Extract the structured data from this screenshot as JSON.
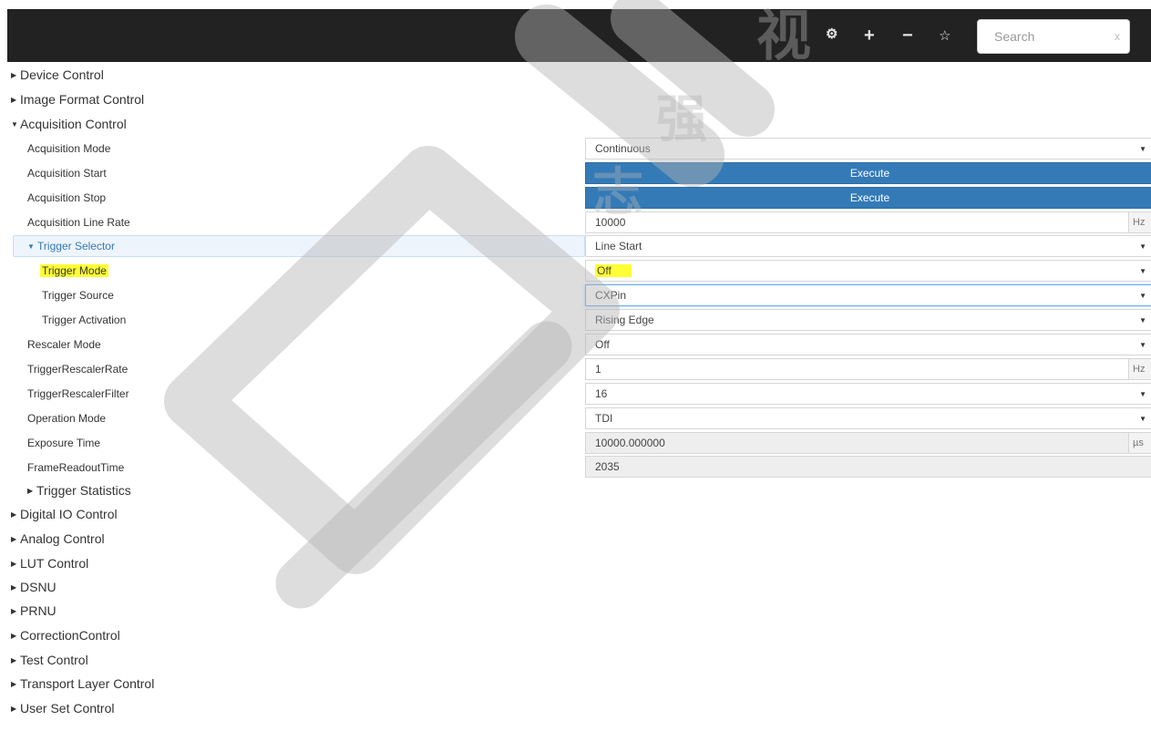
{
  "toolbar": {
    "icons": [
      "gear-icon",
      "plus-icon",
      "minus-icon",
      "star-icon"
    ],
    "search": {
      "placeholder": "Search",
      "clear": "x"
    }
  },
  "tree": {
    "device_control": "Device Control",
    "image_format_control": "Image Format Control",
    "acquisition_control": "Acquisition Control",
    "digital_io_control": "Digital IO Control",
    "analog_control": "Analog Control",
    "lut_control": "LUT Control",
    "dsnu": "DSNU",
    "prnu": "PRNU",
    "correction_control": "CorrectionControl",
    "test_control": "Test Control",
    "transport_layer_control": "Transport Layer Control",
    "user_set_control": "User Set Control",
    "trigger_statistics": "Trigger Statistics"
  },
  "features": {
    "acquisition_mode": {
      "label": "Acquisition Mode",
      "value": "Continuous"
    },
    "acquisition_start": {
      "label": "Acquisition Start",
      "button": "Execute"
    },
    "acquisition_stop": {
      "label": "Acquisition Stop",
      "button": "Execute"
    },
    "acquisition_line_rate": {
      "label": "Acquisition Line Rate",
      "value": "10000",
      "unit": "Hz"
    },
    "trigger_selector": {
      "label": "Trigger Selector",
      "value": "Line Start"
    },
    "trigger_mode": {
      "label": "Trigger Mode",
      "value": "Off"
    },
    "trigger_source": {
      "label": "Trigger Source",
      "value": "CXPin"
    },
    "trigger_activation": {
      "label": "Trigger Activation",
      "value": "Rising Edge"
    },
    "rescaler_mode": {
      "label": "Rescaler Mode",
      "value": "Off"
    },
    "trigger_rescaler_rate": {
      "label": "TriggerRescalerRate",
      "value": "1",
      "unit": "Hz"
    },
    "trigger_rescaler_filter": {
      "label": "TriggerRescalerFilter",
      "value": "16"
    },
    "operation_mode": {
      "label": "Operation Mode",
      "value": "TDI"
    },
    "exposure_time": {
      "label": "Exposure Time",
      "value": "10000.000000",
      "unit": "µs"
    },
    "frame_readout_time": {
      "label": "FrameReadoutTime",
      "value": "2035"
    }
  },
  "colors": {
    "topbar": "#222222",
    "execute": "#337ab7",
    "highlight": "#ffff33",
    "selected_link": "#337ab7"
  },
  "watermark": {
    "logo": "51",
    "chars": [
      "志",
      "强",
      "视"
    ]
  }
}
